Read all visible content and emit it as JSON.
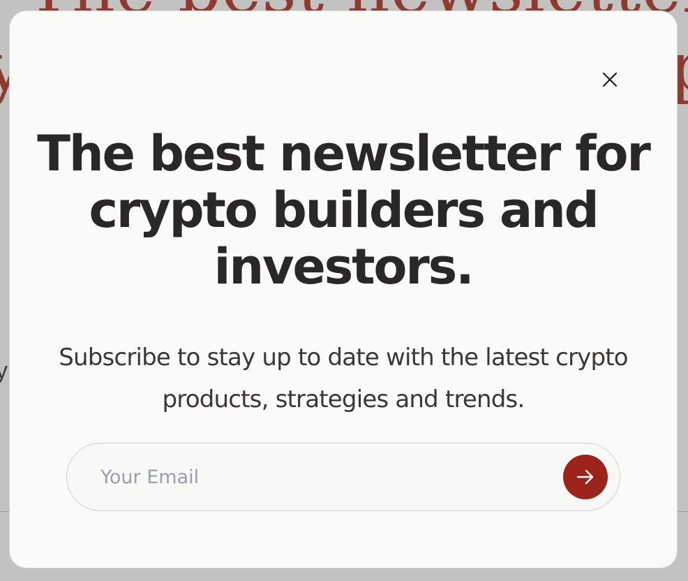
{
  "background": {
    "heading_line1": "The best newsletter for",
    "heading_line2_left": "y",
    "heading_line2_right": "p",
    "fragment_left": "y"
  },
  "modal": {
    "headline": "The best newsletter for crypto builders and investors.",
    "subtext": "Subscribe to stay up to date with the latest crypto products, strategies and trends.",
    "email_placeholder": "Your Email",
    "email_value": "",
    "close_icon": "close-icon",
    "submit_icon": "arrow-right-icon"
  },
  "colors": {
    "accent": "#9b2319",
    "overlay": "#c2c2c1",
    "modal_bg": "#fafaf8",
    "text": "#2a2826",
    "placeholder": "#9aa0aa"
  }
}
